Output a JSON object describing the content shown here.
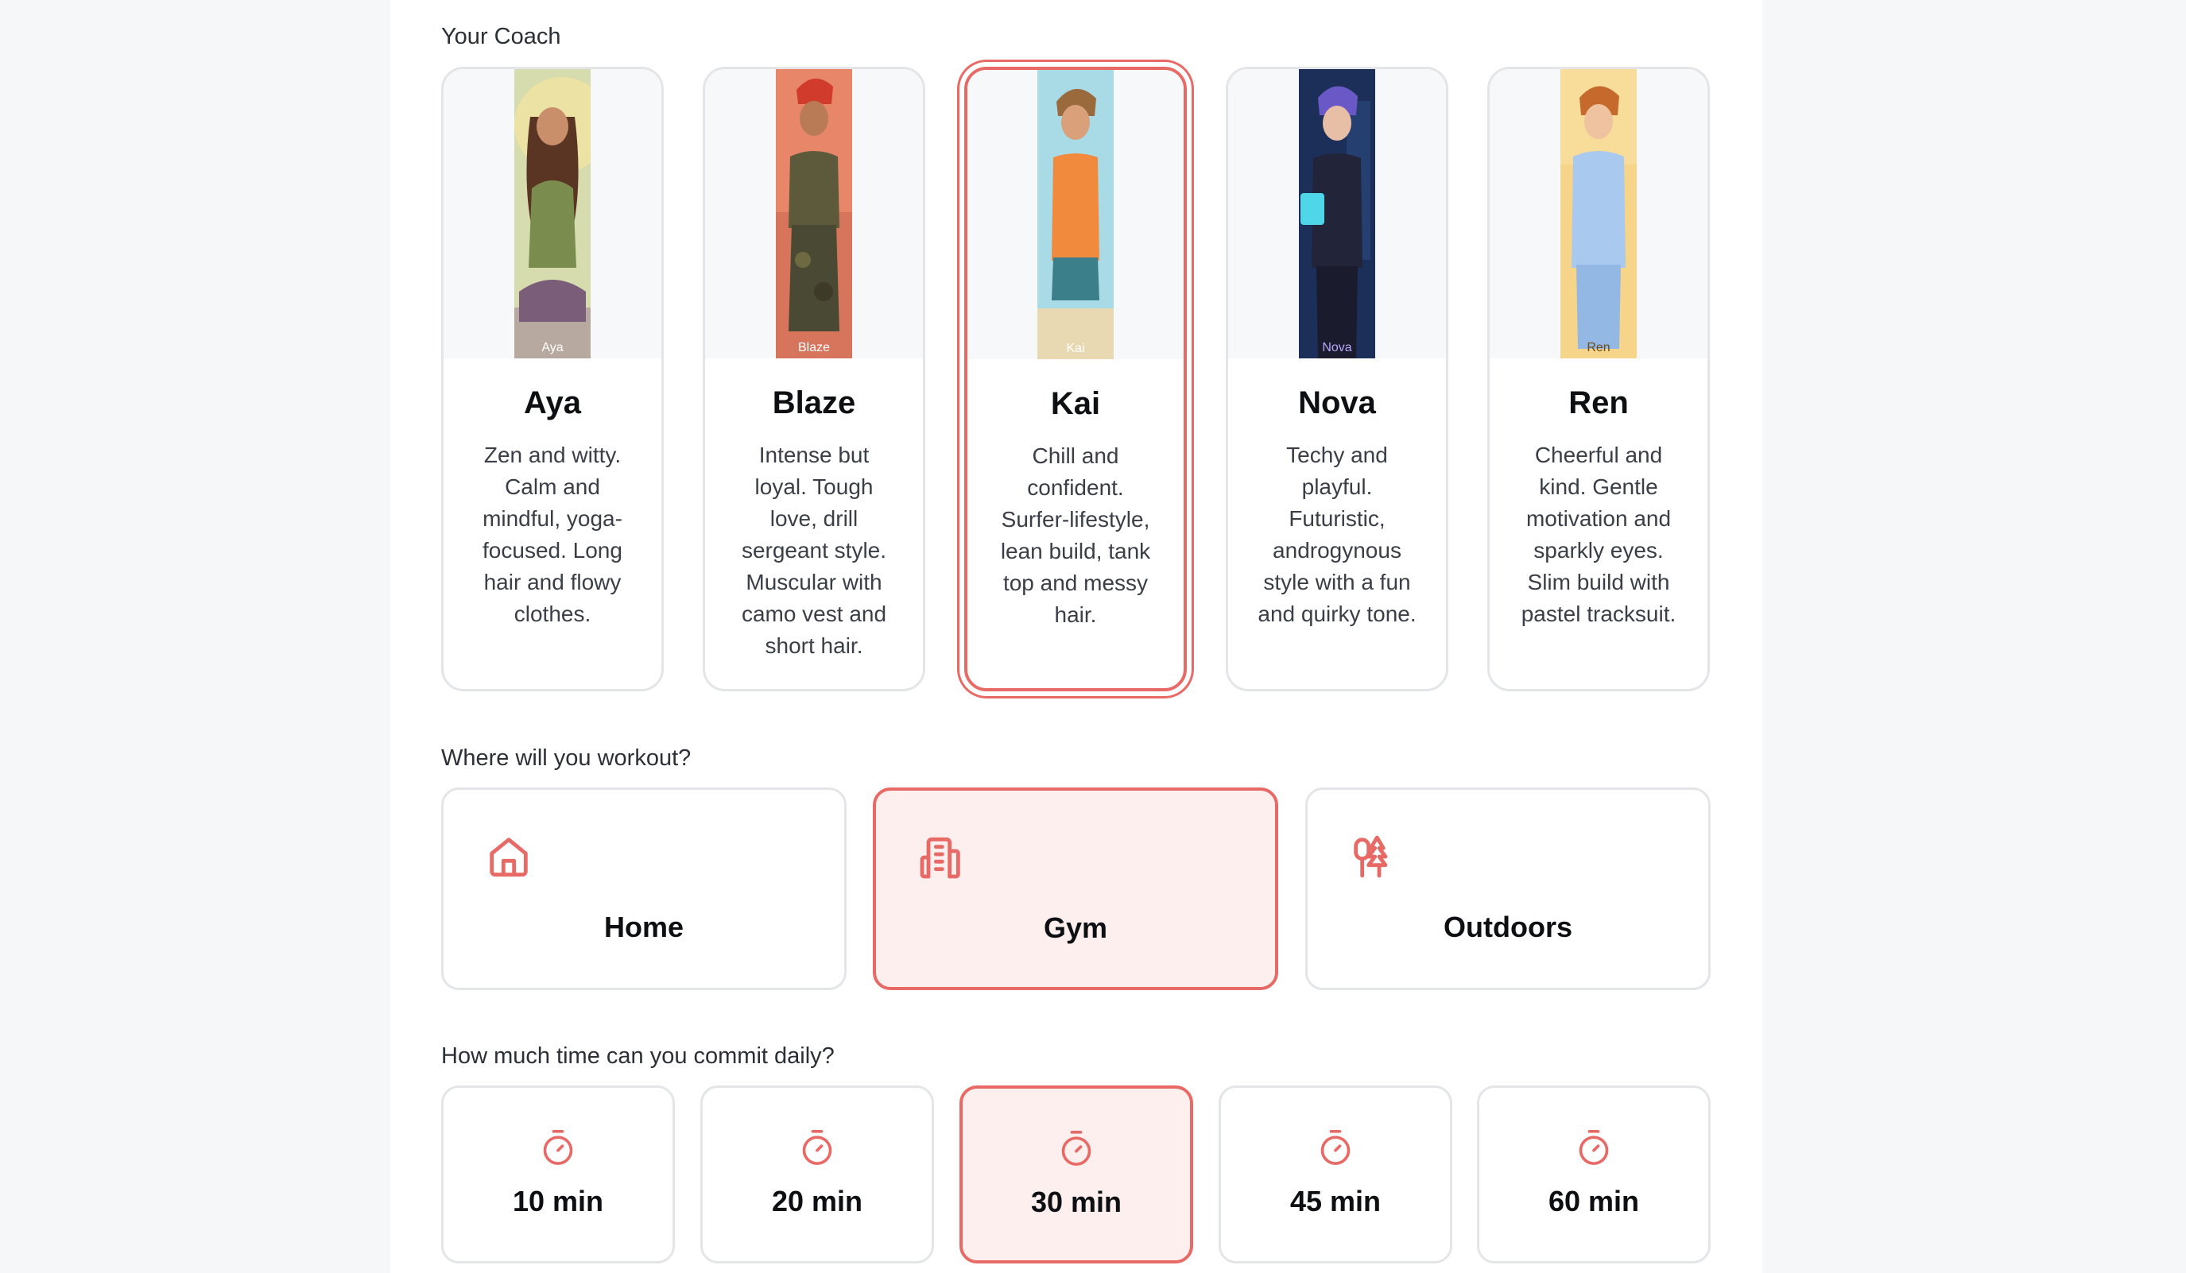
{
  "coach_section": {
    "label": "Your Coach",
    "coaches": [
      {
        "tag": "Aya",
        "name": "Aya",
        "description": "Zen and witty. Calm and mindful, yoga-focused. Long hair and flowy clothes.",
        "selected": false
      },
      {
        "tag": "Blaze",
        "name": "Blaze",
        "description": "Intense but loyal. Tough love, drill sergeant style. Muscular with camo vest and short hair.",
        "selected": false
      },
      {
        "tag": "Kai",
        "name": "Kai",
        "description": "Chill and confident. Surfer-lifestyle, lean build, tank top and messy hair.",
        "selected": true
      },
      {
        "tag": "Nova",
        "name": "Nova",
        "description": "Techy and playful. Futuristic, androgynous style with a fun and quirky tone.",
        "selected": false
      },
      {
        "tag": "Ren",
        "name": "Ren",
        "description": "Cheerful and kind. Gentle motivation and sparkly eyes. Slim build with pastel tracksuit.",
        "selected": false
      }
    ]
  },
  "location_section": {
    "label": "Where will you workout?",
    "options": [
      {
        "label": "Home",
        "icon": "home-icon",
        "selected": false
      },
      {
        "label": "Gym",
        "icon": "building-icon",
        "selected": true
      },
      {
        "label": "Outdoors",
        "icon": "trees-icon",
        "selected": false
      }
    ]
  },
  "time_section": {
    "label": "How much time can you commit daily?",
    "options": [
      {
        "label": "10 min",
        "icon": "timer-icon",
        "selected": false
      },
      {
        "label": "20 min",
        "icon": "timer-icon",
        "selected": false
      },
      {
        "label": "30 min",
        "icon": "timer-icon",
        "selected": true
      },
      {
        "label": "45 min",
        "icon": "timer-icon",
        "selected": false
      },
      {
        "label": "60 min",
        "icon": "timer-icon",
        "selected": false
      }
    ]
  },
  "colors": {
    "accent": "#e86a66",
    "selected_bg": "#fcefee",
    "card_border": "#e3e5e8"
  }
}
